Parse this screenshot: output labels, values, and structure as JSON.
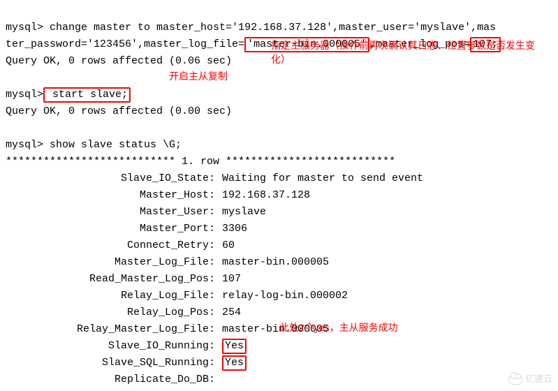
{
  "prompt": "mysql>",
  "cmds": {
    "change_master_head": " change master to master_host='192.168.37.128',master_user='myslave',mas",
    "change_master_tail1": "ter_password='123456',master_log_file=",
    "log_file_boxed": "'master-bin.000005'",
    "change_master_tail2": ",master_log_pos=",
    "log_pos_boxed": "107;",
    "query_ok1": "Query OK, 0 rows affected (0.06 sec)",
    "start_slave_boxed": " start slave;",
    "query_ok2": "Query OK, 0 rows affected (0.00 sec)",
    "show_status": " show slave status \\G;",
    "row_header": "*************************** 1. row ***************************"
  },
  "annotations": {
    "spec_master": "指定主服务器（操作前再次确认其日志、位置参数是否发生变化）",
    "start_replication": "开启主从复制",
    "two_yes": "此处2个yes，主从服务成功"
  },
  "status": [
    {
      "k": "Slave_IO_State",
      "v": "Waiting for master to send event",
      "box": false
    },
    {
      "k": "Master_Host",
      "v": "192.168.37.128",
      "box": false
    },
    {
      "k": "Master_User",
      "v": "myslave",
      "box": false
    },
    {
      "k": "Master_Port",
      "v": "3306",
      "box": false
    },
    {
      "k": "Connect_Retry",
      "v": "60",
      "box": false
    },
    {
      "k": "Master_Log_File",
      "v": "master-bin.000005",
      "box": false
    },
    {
      "k": "Read_Master_Log_Pos",
      "v": "107",
      "box": false
    },
    {
      "k": "Relay_Log_File",
      "v": "relay-log-bin.000002",
      "box": false
    },
    {
      "k": "Relay_Log_Pos",
      "v": "254",
      "box": false
    },
    {
      "k": "Relay_Master_Log_File",
      "v": "master-bin.000005",
      "box": false
    },
    {
      "k": "Slave_IO_Running",
      "v": "Yes",
      "box": true
    },
    {
      "k": "Slave_SQL_Running",
      "v": "Yes",
      "box": true
    },
    {
      "k": "Replicate_Do_DB",
      "v": "",
      "box": false
    }
  ],
  "watermark": "亿速云"
}
